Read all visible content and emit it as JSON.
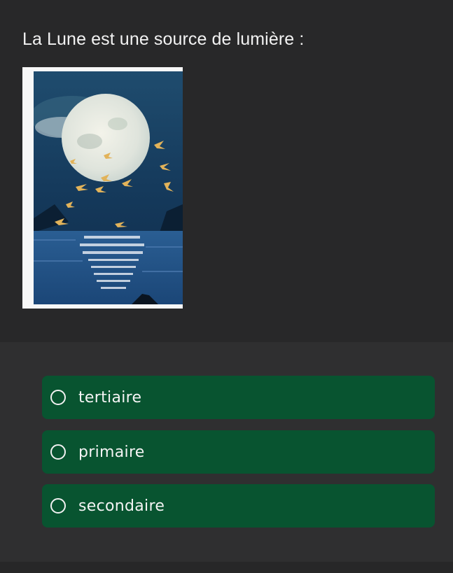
{
  "question": {
    "text": "La Lune est une source de lumière :"
  },
  "image": {
    "subject": "moon-painting"
  },
  "options": [
    {
      "label": "tertiaire"
    },
    {
      "label": "primaire"
    },
    {
      "label": "secondaire"
    }
  ],
  "colors": {
    "option_background": "#085430",
    "page_background": "#282829",
    "text": "#f2f2f2"
  }
}
